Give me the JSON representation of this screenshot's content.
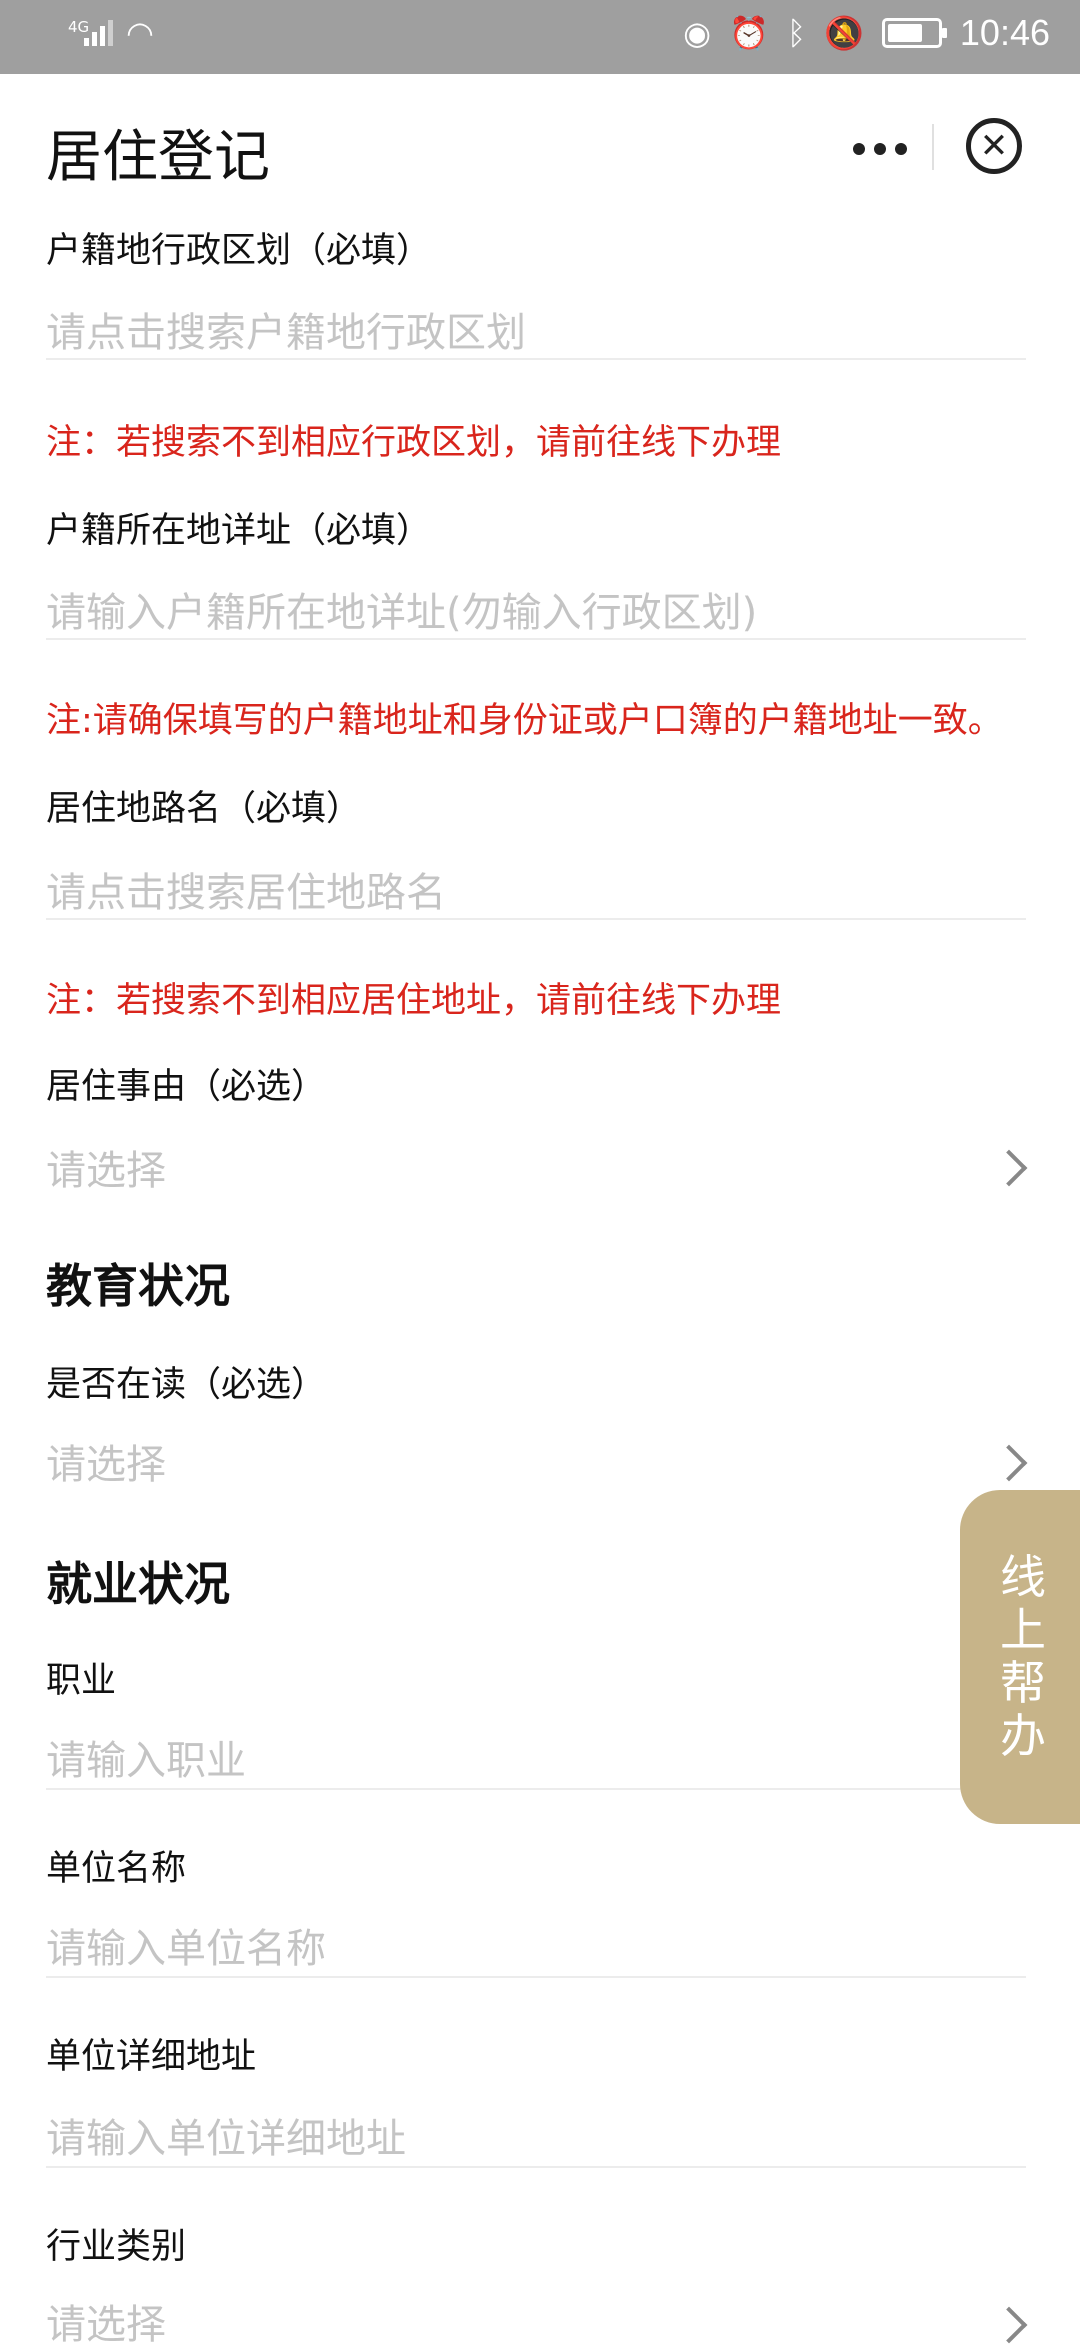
{
  "status_bar": {
    "network": "4G",
    "time": "10:46"
  },
  "header": {
    "title": "居住登记"
  },
  "form": {
    "hukou_region": {
      "label": "户籍地行政区划（必填）",
      "placeholder": "请点击搜索户籍地行政区划"
    },
    "note1": "注：若搜索不到相应行政区划，请前往线下办理",
    "hukou_address": {
      "label": "户籍所在地详址（必填）",
      "placeholder": "请输入户籍所在地详址(勿输入行政区划)"
    },
    "note2": "注:请确保填写的户籍地址和身份证或户口簿的户籍地址一致。",
    "residence_road": {
      "label": "居住地路名（必填）",
      "placeholder": "请点击搜索居住地路名"
    },
    "note3": "注：若搜索不到相应居住地址，请前往线下办理",
    "residence_reason": {
      "label": "居住事由（必选）",
      "placeholder": "请选择"
    }
  },
  "education": {
    "title": "教育状况",
    "in_school": {
      "label": "是否在读（必选）",
      "placeholder": "请选择"
    }
  },
  "employment": {
    "title": "就业状况",
    "occupation": {
      "label": "职业",
      "placeholder": "请输入职业"
    },
    "company_name": {
      "label": "单位名称",
      "placeholder": "请输入单位名称"
    },
    "company_address": {
      "label": "单位详细地址",
      "placeholder": "请输入单位详细地址"
    },
    "industry": {
      "label": "行业类别",
      "placeholder": "请选择"
    }
  },
  "help_button": {
    "chars": [
      "线",
      "上",
      "帮",
      "办"
    ]
  },
  "colors": {
    "note_red": "#d9251c",
    "help_gold": "#c7b489",
    "placeholder_gray": "#c4c4c4"
  }
}
